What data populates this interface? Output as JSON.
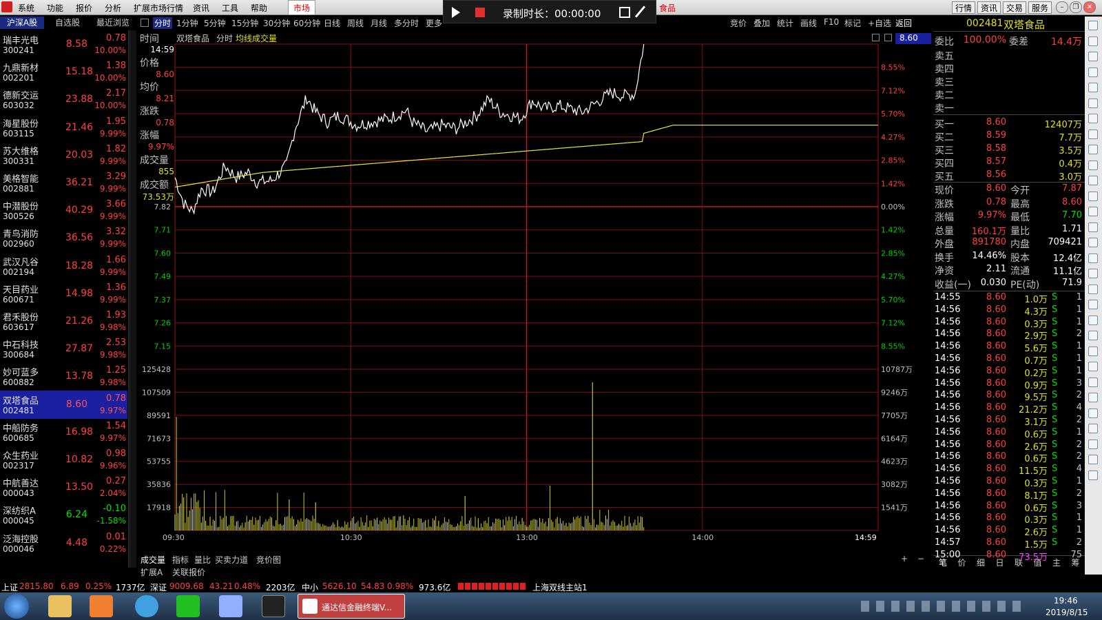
{
  "menu": {
    "items": [
      "系统",
      "功能",
      "报价",
      "分析",
      "扩展市场行情",
      "资讯",
      "工具",
      "帮助"
    ],
    "market": "市场",
    "app_title_frag": "食品"
  },
  "recorder": {
    "label": "录制时长：00:00:00"
  },
  "top_right_tabs": [
    "行情",
    "资讯",
    "交易",
    "服务"
  ],
  "side_tabs": [
    "沪深A股",
    "自选股",
    "最近浏览"
  ],
  "period_tabs": [
    "分时",
    "1分钟",
    "5分钟",
    "15分钟",
    "30分钟",
    "60分钟",
    "日线",
    "周线",
    "月线",
    "多分时",
    "更多"
  ],
  "tool_tabs": [
    "竞价",
    "叠加",
    "统计",
    "画线",
    "F10",
    "标记",
    "+自选",
    "返回"
  ],
  "stocks": [
    {
      "name": "瑞丰光电",
      "code": "300241",
      "price": "8.58",
      "chg": "0.78",
      "pct": "10.00%"
    },
    {
      "name": "九鼎新材",
      "code": "002201",
      "price": "15.18",
      "chg": "1.38",
      "pct": "10.00%"
    },
    {
      "name": "德新交运",
      "code": "603032",
      "price": "23.88",
      "chg": "2.17",
      "pct": "10.00%"
    },
    {
      "name": "海星股份",
      "code": "603115",
      "price": "21.46",
      "chg": "1.95",
      "pct": "9.99%"
    },
    {
      "name": "苏大维格",
      "code": "300331",
      "price": "20.03",
      "chg": "1.82",
      "pct": "9.99%"
    },
    {
      "name": "美格智能",
      "code": "002881",
      "price": "36.21",
      "chg": "3.29",
      "pct": "9.99%"
    },
    {
      "name": "中潜股份",
      "code": "300526",
      "price": "40.29",
      "chg": "3.66",
      "pct": "9.99%"
    },
    {
      "name": "青鸟消防",
      "code": "002960",
      "price": "36.56",
      "chg": "3.32",
      "pct": "9.99%"
    },
    {
      "name": "武汉凡谷",
      "code": "002194",
      "price": "18.28",
      "chg": "1.66",
      "pct": "9.99%"
    },
    {
      "name": "天目药业",
      "code": "600671",
      "price": "14.98",
      "chg": "1.36",
      "pct": "9.99%"
    },
    {
      "name": "君禾股份",
      "code": "603617",
      "price": "21.26",
      "chg": "1.93",
      "pct": "9.98%"
    },
    {
      "name": "中石科技",
      "code": "300684",
      "price": "27.87",
      "chg": "2.53",
      "pct": "9.98%"
    },
    {
      "name": "妙可蓝多",
      "code": "600882",
      "price": "13.78",
      "chg": "1.25",
      "pct": "9.98%"
    },
    {
      "name": "双塔食品",
      "code": "002481",
      "price": "8.60",
      "chg": "0.78",
      "pct": "9.97%"
    },
    {
      "name": "中船防务",
      "code": "600685",
      "price": "16.98",
      "chg": "1.54",
      "pct": "9.97%"
    },
    {
      "name": "众生药业",
      "code": "002317",
      "price": "10.82",
      "chg": "0.98",
      "pct": "9.96%"
    },
    {
      "name": "中航善达",
      "code": "000043",
      "price": "13.50",
      "chg": "0.27",
      "pct": "2.04%"
    },
    {
      "name": "深纺织A",
      "code": "000045",
      "price": "6.24",
      "chg": "-0.10",
      "pct": "-1.58%"
    },
    {
      "name": "泛海控股",
      "code": "000046",
      "price": "4.48",
      "chg": "0.01",
      "pct": "0.22%"
    }
  ],
  "chart_head": {
    "name": "双塔食品",
    "mode": "分时",
    "avg": "均线",
    "vol": "成交量"
  },
  "info": {
    "time_lbl": "时间",
    "time": "14:59",
    "price_lbl": "价格",
    "price": "8.60",
    "avg_lbl": "均价",
    "avg": "8.21",
    "chg_lbl": "涨跌",
    "chg": "0.78",
    "pct_lbl": "涨幅",
    "pct": "9.97%",
    "vol_lbl": "成交量",
    "vol": "855",
    "amt_lbl": "成交额",
    "amt": "73.53万"
  },
  "price_axis_left": [
    "7.82",
    "7.71",
    "7.60",
    "7.49",
    "7.37",
    "7.26",
    "7.15"
  ],
  "pct_axis_right": [
    "8.55%",
    "7.12%",
    "5.70%",
    "4.27%",
    "2.85%",
    "1.42%",
    "0.00%",
    "1.42%",
    "2.85%",
    "4.27%",
    "5.70%",
    "7.12%",
    "8.55%"
  ],
  "top_price": "8.60",
  "vol_axis_left": [
    "125428",
    "107509",
    "89591",
    "71673",
    "53755",
    "35836",
    "17918"
  ],
  "vol_axis_right": [
    "10787万",
    "9246万",
    "7705万",
    "6164万",
    "4623万",
    "3082万",
    "1541万"
  ],
  "time_axis": [
    "09:30",
    "10:30",
    "13:00",
    "14:00",
    "14:59"
  ],
  "bottom_tabs": [
    "成交量",
    "指标",
    "量比",
    "买卖力道",
    "竞价图"
  ],
  "bottom_tabs2": [
    "扩展A",
    "关联报价"
  ],
  "quote": {
    "code": "002481",
    "name": "双塔食品",
    "wb_lbl": "委比",
    "wb": "100.00%",
    "wc_lbl": "委差",
    "wc": "14.4万",
    "sell": [
      "卖五",
      "卖四",
      "卖三",
      "卖二",
      "卖一"
    ],
    "buy": [
      {
        "l": "买一",
        "p": "8.60",
        "v": "12407万"
      },
      {
        "l": "买二",
        "p": "8.59",
        "v": "7.7万"
      },
      {
        "l": "买三",
        "p": "8.58",
        "v": "3.5万"
      },
      {
        "l": "买四",
        "p": "8.57",
        "v": "0.4万"
      },
      {
        "l": "买五",
        "p": "8.56",
        "v": "3.0万"
      }
    ],
    "stats": [
      {
        "a": "现价",
        "b": "8.60",
        "c": "今开",
        "d": "7.87"
      },
      {
        "a": "涨跌",
        "b": "0.78",
        "c": "最高",
        "d": "8.60"
      },
      {
        "a": "涨幅",
        "b": "9.97%",
        "c": "最低",
        "d": "7.70"
      },
      {
        "a": "总量",
        "b": "160.1万",
        "c": "量比",
        "d": "1.71"
      },
      {
        "a": "外盘",
        "b": "891780",
        "c": "内盘",
        "d": "709421"
      },
      {
        "a": "换手",
        "b": "14.46%",
        "c": "股本",
        "d": "12.4亿"
      },
      {
        "a": "净资",
        "b": "2.11",
        "c": "流通",
        "d": "11.1亿"
      },
      {
        "a": "收益(一)",
        "b": "0.030",
        "c": "PE(动)",
        "d": "71.9"
      }
    ]
  },
  "ticks": [
    [
      "14:55",
      "8.60",
      "1.0万",
      "S",
      "1"
    ],
    [
      "14:56",
      "8.60",
      "4.3万",
      "S",
      "1"
    ],
    [
      "14:56",
      "8.60",
      "0.3万",
      "S",
      "1"
    ],
    [
      "14:56",
      "8.60",
      "2.9万",
      "S",
      "2"
    ],
    [
      "14:56",
      "8.60",
      "5.6万",
      "S",
      "1"
    ],
    [
      "14:56",
      "8.60",
      "0.7万",
      "S",
      "1"
    ],
    [
      "14:56",
      "8.60",
      "0.2万",
      "S",
      "1"
    ],
    [
      "14:56",
      "8.60",
      "0.9万",
      "S",
      "3"
    ],
    [
      "14:56",
      "8.60",
      "9.5万",
      "S",
      "2"
    ],
    [
      "14:56",
      "8.60",
      "21.2万",
      "S",
      "4"
    ],
    [
      "14:56",
      "8.60",
      "3.1万",
      "S",
      "2"
    ],
    [
      "14:56",
      "8.60",
      "0.6万",
      "S",
      "1"
    ],
    [
      "14:56",
      "8.60",
      "2.6万",
      "S",
      "2"
    ],
    [
      "14:56",
      "8.60",
      "0.6万",
      "S",
      "2"
    ],
    [
      "14:56",
      "8.60",
      "11.5万",
      "S",
      "4"
    ],
    [
      "14:56",
      "8.60",
      "0.3万",
      "S",
      "1"
    ],
    [
      "14:56",
      "8.60",
      "8.1万",
      "S",
      "2"
    ],
    [
      "14:56",
      "8.60",
      "0.6万",
      "S",
      "3"
    ],
    [
      "14:56",
      "8.60",
      "0.3万",
      "S",
      "1"
    ],
    [
      "14:56",
      "8.60",
      "2.6万",
      "S",
      "1"
    ],
    [
      "14:57",
      "8.60",
      "1.5万",
      "S",
      "2"
    ],
    [
      "15:00",
      "8.60",
      "73.5万",
      "",
      "75"
    ]
  ],
  "rp_bottom_tabs": [
    "笔",
    "价",
    "细",
    "日",
    "联",
    "值",
    "主",
    "筹"
  ],
  "status": {
    "sh_lbl": "上证",
    "sh": "2815.80",
    "sh_chg": "6.89",
    "sh_pct": "0.25%",
    "sh_amt": "1737亿",
    "sz_lbl": "深证",
    "sz": "9009.68",
    "sz_chg": "43.21",
    "sz_pct": "0.48%",
    "sz_amt": "2203亿",
    "zx_lbl": "中小",
    "zx": "5626.10",
    "zx_chg": "54.83",
    "zx_pct": "0.98%",
    "zx_amt": "973.6亿",
    "server": "上海双线主站1"
  },
  "taskbar": {
    "app": "通达信金融终端V...",
    "time": "19:46",
    "date": "2019/8/15"
  },
  "chart_data": {
    "type": "line",
    "series": [
      {
        "name": "价格"
      },
      {
        "name": "均价"
      }
    ],
    "prev_close": 7.82,
    "ylim": [
      7.04,
      8.6
    ],
    "time_axis": [
      "09:30",
      "10:30",
      "13:00",
      "14:00",
      "14:59"
    ]
  }
}
